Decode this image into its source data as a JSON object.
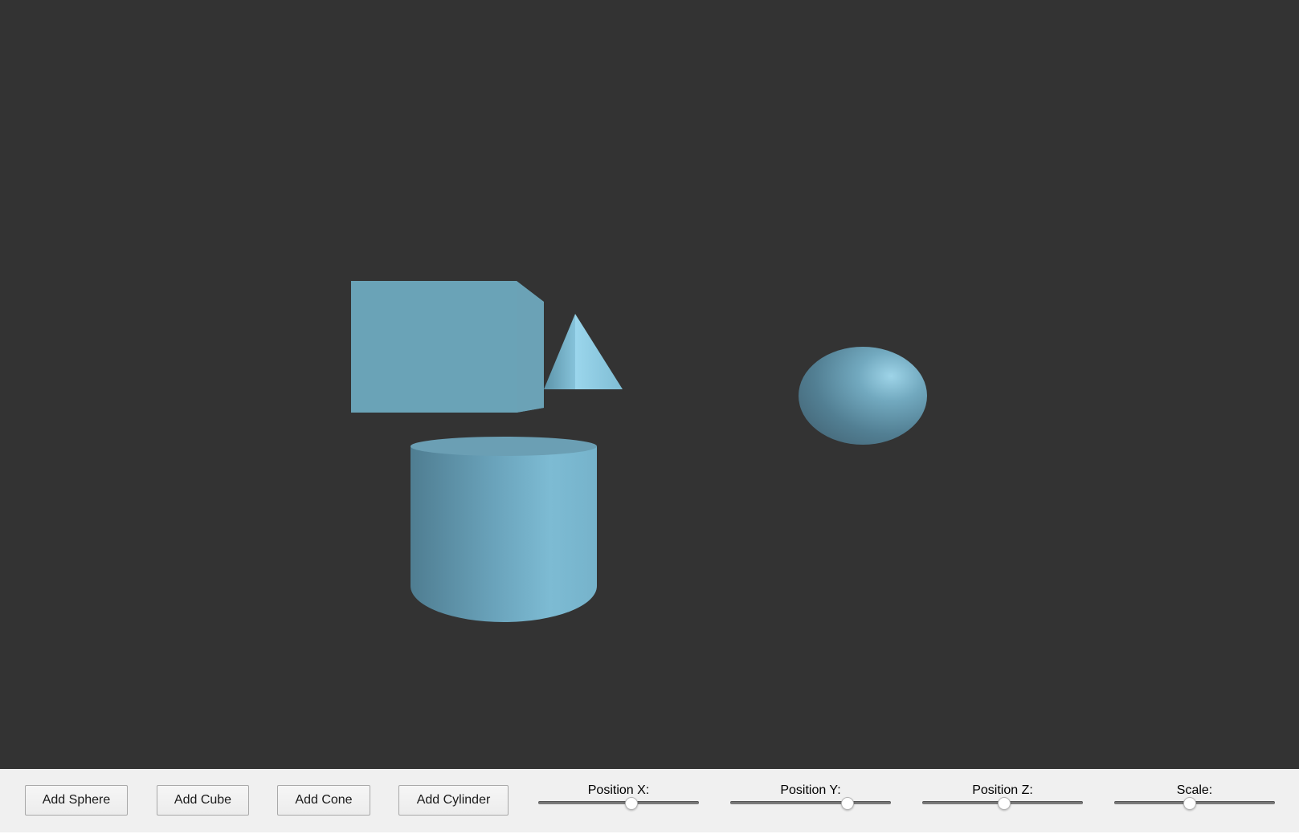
{
  "scene": {
    "background_color": "#333333",
    "object_color": "#6fa8bd",
    "objects": [
      "cube",
      "cone",
      "cylinder",
      "sphere"
    ]
  },
  "toolbar": {
    "buttons": {
      "add_sphere": "Add Sphere",
      "add_cube": "Add Cube",
      "add_cone": "Add Cone",
      "add_cylinder": "Add Cylinder"
    },
    "sliders": {
      "position_x": {
        "label": "Position X:",
        "value_fraction": 0.58
      },
      "position_y": {
        "label": "Position Y:",
        "value_fraction": 0.73
      },
      "position_z": {
        "label": "Position Z:",
        "value_fraction": 0.51
      },
      "scale": {
        "label": "Scale:",
        "value_fraction": 0.47
      }
    }
  }
}
